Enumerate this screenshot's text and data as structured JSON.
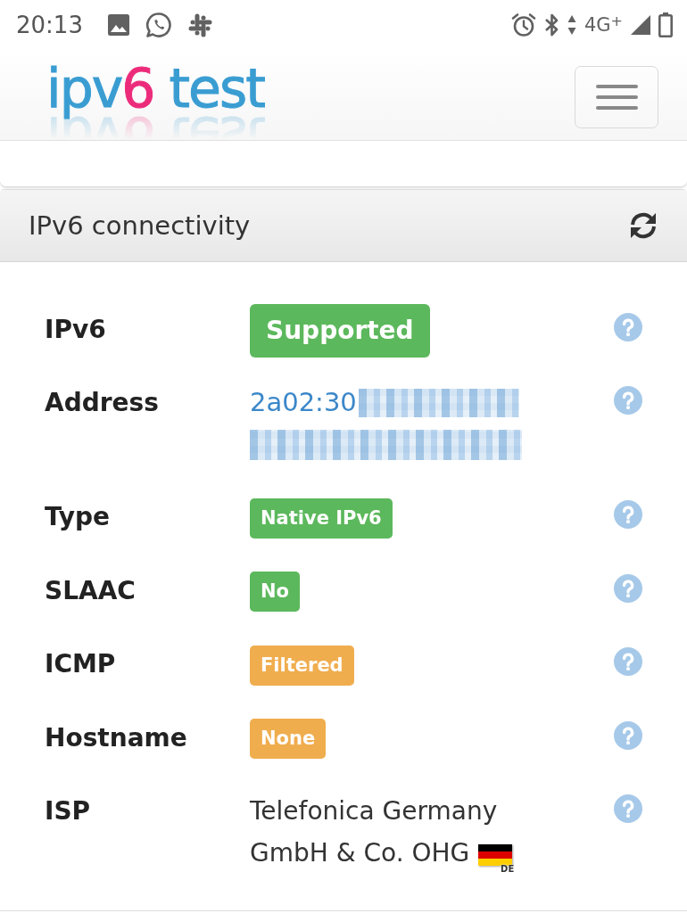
{
  "status_bar": {
    "time": "20:13",
    "network": "4G$^{+}$"
  },
  "navbar": {
    "logo": [
      {
        "text": "ipv",
        "accent": false
      },
      {
        "text": "6",
        "accent": true
      },
      {
        "text": " test",
        "accent": false
      }
    ]
  },
  "panel": {
    "title": "IPv6 connectivity",
    "rows": [
      {
        "label": "IPv6",
        "kind": "badge",
        "value": "Supported",
        "color": "#5cb85c",
        "large": true
      },
      {
        "label": "Address",
        "kind": "address",
        "value": "2a02:30",
        "redacted": true
      },
      {
        "label": "Type",
        "kind": "badge",
        "value": "Native IPv6",
        "color": "#5cb85c",
        "large": false
      },
      {
        "label": "SLAAC",
        "kind": "badge",
        "value": "No",
        "color": "#5cb85c",
        "large": false
      },
      {
        "label": "ICMP",
        "kind": "badge",
        "value": "Filtered",
        "color": "#f0ad4e",
        "large": false
      },
      {
        "label": "Hostname",
        "kind": "badge",
        "value": "None",
        "color": "#f0ad4e",
        "large": false
      },
      {
        "label": "ISP",
        "kind": "text",
        "lines": [
          "Telefonica Germany",
          "GmbH & Co. OHG"
        ],
        "flag_code": "DE"
      }
    ]
  }
}
